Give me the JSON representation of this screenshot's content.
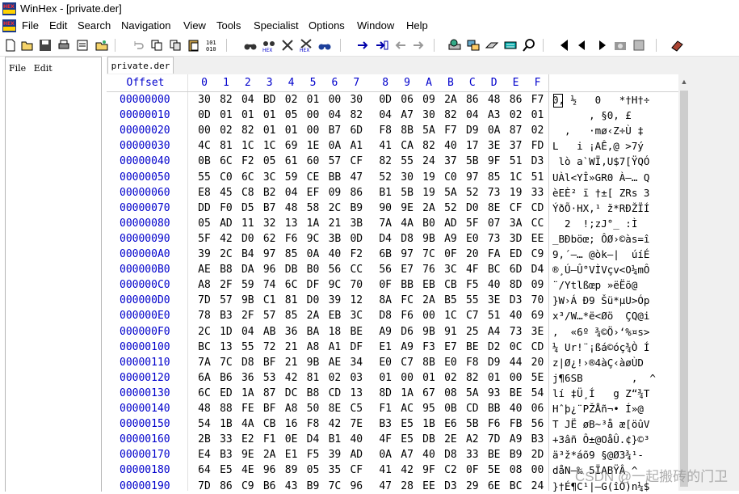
{
  "window": {
    "title": "WinHex - [private.der]"
  },
  "menu": [
    "File",
    "Edit",
    "Search",
    "Navigation",
    "View",
    "Tools",
    "Specialist",
    "Options",
    "Window",
    "Help"
  ],
  "left_panel": {
    "menu": [
      "File",
      "Edit"
    ]
  },
  "document_tab": "private.der",
  "hex_header": {
    "offset_label": "Offset",
    "columns": [
      "0",
      "1",
      "2",
      "3",
      "4",
      "5",
      "6",
      "7",
      "8",
      "9",
      "A",
      "B",
      "C",
      "D",
      "E",
      "F"
    ]
  },
  "rows": [
    {
      "offset": "00000000",
      "bytes": [
        "30",
        "82",
        "04",
        "BD",
        "02",
        "01",
        "00",
        "30",
        "0D",
        "06",
        "09",
        "2A",
        "86",
        "48",
        "86",
        "F7"
      ],
      "ascii": "0‚ ½   0   *†H†÷"
    },
    {
      "offset": "00000010",
      "bytes": [
        "0D",
        "01",
        "01",
        "01",
        "05",
        "00",
        "04",
        "82",
        "04",
        "A7",
        "30",
        "82",
        "04",
        "A3",
        "02",
        "01"
      ],
      "ascii": "      ‚ §0‚ £  "
    },
    {
      "offset": "00000020",
      "bytes": [
        "00",
        "02",
        "82",
        "01",
        "01",
        "00",
        "B7",
        "6D",
        "F8",
        "8B",
        "5A",
        "F7",
        "D9",
        "0A",
        "87",
        "02"
      ],
      "ascii": "  ‚   ·mø‹Z÷Ù ‡ "
    },
    {
      "offset": "00000030",
      "bytes": [
        "4C",
        "81",
        "1C",
        "1C",
        "69",
        "1E",
        "0A",
        "A1",
        "41",
        "CA",
        "82",
        "40",
        "17",
        "3E",
        "37",
        "FD"
      ],
      "ascii": "L   i ¡AÊ‚@ >7ý"
    },
    {
      "offset": "00000040",
      "bytes": [
        "0B",
        "6C",
        "F2",
        "05",
        "61",
        "60",
        "57",
        "CF",
        "82",
        "55",
        "24",
        "37",
        "5B",
        "9F",
        "51",
        "D3"
      ],
      "ascii": " lò a`WÏ‚U$7[ŸQÓ"
    },
    {
      "offset": "00000050",
      "bytes": [
        "55",
        "C0",
        "6C",
        "3C",
        "59",
        "CE",
        "BB",
        "47",
        "52",
        "30",
        "19",
        "C0",
        "97",
        "85",
        "1C",
        "51"
      ],
      "ascii": "UÀl<YÎ»GR0 À—… Q"
    },
    {
      "offset": "00000060",
      "bytes": [
        "E8",
        "45",
        "C8",
        "B2",
        "04",
        "EF",
        "09",
        "86",
        "B1",
        "5B",
        "19",
        "5A",
        "52",
        "73",
        "19",
        "33"
      ],
      "ascii": "èEÈ² ï †±[ ZRs 3"
    },
    {
      "offset": "00000070",
      "bytes": [
        "DD",
        "F0",
        "D5",
        "B7",
        "48",
        "58",
        "2C",
        "B9",
        "90",
        "9E",
        "2A",
        "52",
        "D0",
        "8E",
        "CF",
        "CD"
      ],
      "ascii": "ÝðÕ·HX,¹ ž*RÐŽÏÍ"
    },
    {
      "offset": "00000080",
      "bytes": [
        "05",
        "AD",
        "11",
        "32",
        "13",
        "1A",
        "21",
        "3B",
        "7A",
        "4A",
        "B0",
        "AD",
        "5F",
        "07",
        "3A",
        "CC"
      ],
      "ascii": " ­ 2  !;zJ°­_ :Ì"
    },
    {
      "offset": "00000090",
      "bytes": [
        "5F",
        "42",
        "D0",
        "62",
        "F6",
        "9C",
        "3B",
        "0D",
        "D4",
        "D8",
        "9B",
        "A9",
        "E0",
        "73",
        "3D",
        "EE"
      ],
      "ascii": "_BÐböœ; ÔØ›©às=î"
    },
    {
      "offset": "000000A0",
      "bytes": [
        "39",
        "2C",
        "B4",
        "97",
        "85",
        "0A",
        "40",
        "F2",
        "6B",
        "97",
        "7C",
        "0F",
        "20",
        "FA",
        "ED",
        "C9"
      ],
      "ascii": "9,´—… @òk—|  úíÉ"
    },
    {
      "offset": "000000B0",
      "bytes": [
        "AE",
        "B8",
        "DA",
        "96",
        "DB",
        "B0",
        "56",
        "CC",
        "56",
        "E7",
        "76",
        "3C",
        "4F",
        "BC",
        "6D",
        "D4"
      ],
      "ascii": "®¸Ú–Û°VÌVçv<O¼mÔ"
    },
    {
      "offset": "000000C0",
      "bytes": [
        "A8",
        "2F",
        "59",
        "74",
        "6C",
        "DF",
        "9C",
        "70",
        "0F",
        "BB",
        "EB",
        "CB",
        "F5",
        "40",
        "8D",
        "09"
      ],
      "ascii": "¨/Ytlßœp »ëËõ@  "
    },
    {
      "offset": "000000D0",
      "bytes": [
        "7D",
        "57",
        "9B",
        "C1",
        "81",
        "D0",
        "39",
        "12",
        "8A",
        "FC",
        "2A",
        "B5",
        "55",
        "3E",
        "D3",
        "70"
      ],
      "ascii": "}W›Á Ð9 Šü*µU>Óp"
    },
    {
      "offset": "000000E0",
      "bytes": [
        "78",
        "B3",
        "2F",
        "57",
        "85",
        "2A",
        "EB",
        "3C",
        "D8",
        "F6",
        "00",
        "1C",
        "C7",
        "51",
        "40",
        "69"
      ],
      "ascii": "x³/W…*ë<Øö  ÇQ@i"
    },
    {
      "offset": "000000F0",
      "bytes": [
        "2C",
        "1D",
        "04",
        "AB",
        "36",
        "BA",
        "18",
        "BE",
        "A9",
        "D6",
        "9B",
        "91",
        "25",
        "A4",
        "73",
        "3E"
      ],
      "ascii": ",  «6º ¾©Ö›‘%¤s>"
    },
    {
      "offset": "00000100",
      "bytes": [
        "BC",
        "13",
        "55",
        "72",
        "21",
        "A8",
        "A1",
        "DF",
        "E1",
        "A9",
        "F3",
        "E7",
        "BE",
        "D2",
        "0C",
        "CD"
      ],
      "ascii": "¼ Ur!¨¡ßá©óç¾Ò Í"
    },
    {
      "offset": "00000110",
      "bytes": [
        "7A",
        "7C",
        "D8",
        "BF",
        "21",
        "9B",
        "AE",
        "34",
        "E0",
        "C7",
        "8B",
        "E0",
        "F8",
        "D9",
        "44",
        "20"
      ],
      "ascii": "z|Ø¿!›®4àÇ‹àøÙD "
    },
    {
      "offset": "00000120",
      "bytes": [
        "6A",
        "B6",
        "36",
        "53",
        "42",
        "81",
        "02",
        "03",
        "01",
        "00",
        "01",
        "02",
        "82",
        "01",
        "00",
        "5E"
      ],
      "ascii": "j¶6SB        ‚  ^"
    },
    {
      "offset": "00000130",
      "bytes": [
        "6C",
        "ED",
        "1A",
        "87",
        "DC",
        "B8",
        "CD",
        "13",
        "8D",
        "1A",
        "67",
        "08",
        "5A",
        "93",
        "BE",
        "54"
      ],
      "ascii": "lí ‡Ü¸Í   g Z“¾T"
    },
    {
      "offset": "00000140",
      "bytes": [
        "48",
        "88",
        "FE",
        "BF",
        "A8",
        "50",
        "8E",
        "C5",
        "F1",
        "AC",
        "95",
        "0B",
        "CD",
        "BB",
        "40",
        "06"
      ],
      "ascii": "Hˆþ¿¨PŽÅñ¬• Í»@ "
    },
    {
      "offset": "00000150",
      "bytes": [
        "54",
        "1B",
        "4A",
        "CB",
        "16",
        "F8",
        "42",
        "7E",
        "B3",
        "E5",
        "1B",
        "E6",
        "5B",
        "F6",
        "FB",
        "56"
      ],
      "ascii": "T JË øB~³å æ[öûV"
    },
    {
      "offset": "00000160",
      "bytes": [
        "2B",
        "33",
        "E2",
        "F1",
        "0E",
        "D4",
        "B1",
        "40",
        "4F",
        "E5",
        "DB",
        "2E",
        "A2",
        "7D",
        "A9",
        "B3"
      ],
      "ascii": "+3âñ Ô±@OåÛ.¢}©³"
    },
    {
      "offset": "00000170",
      "bytes": [
        "E4",
        "B3",
        "9E",
        "2A",
        "E1",
        "F5",
        "39",
        "AD",
        "0A",
        "A7",
        "40",
        "D8",
        "33",
        "BE",
        "B9",
        "2D"
      ],
      "ascii": "ä³ž*áõ9­ §@Ø3¾¹-"
    },
    {
      "offset": "00000180",
      "bytes": [
        "64",
        "E5",
        "4E",
        "96",
        "89",
        "05",
        "35",
        "CF",
        "41",
        "42",
        "9F",
        "C2",
        "0F",
        "5E",
        "08",
        "00"
      ],
      "ascii": "dåN–‰ 5ÏABŸÂ ^  "
    },
    {
      "offset": "00000190",
      "bytes": [
        "7D",
        "86",
        "C9",
        "B6",
        "43",
        "B9",
        "7C",
        "96",
        "47",
        "28",
        "EE",
        "D3",
        "29",
        "6E",
        "BC",
        "24"
      ],
      "ascii": "}†É¶C¹|–G(îÓ)n¼$"
    }
  ],
  "watermark": "CSDN @一起搬砖的门卫"
}
